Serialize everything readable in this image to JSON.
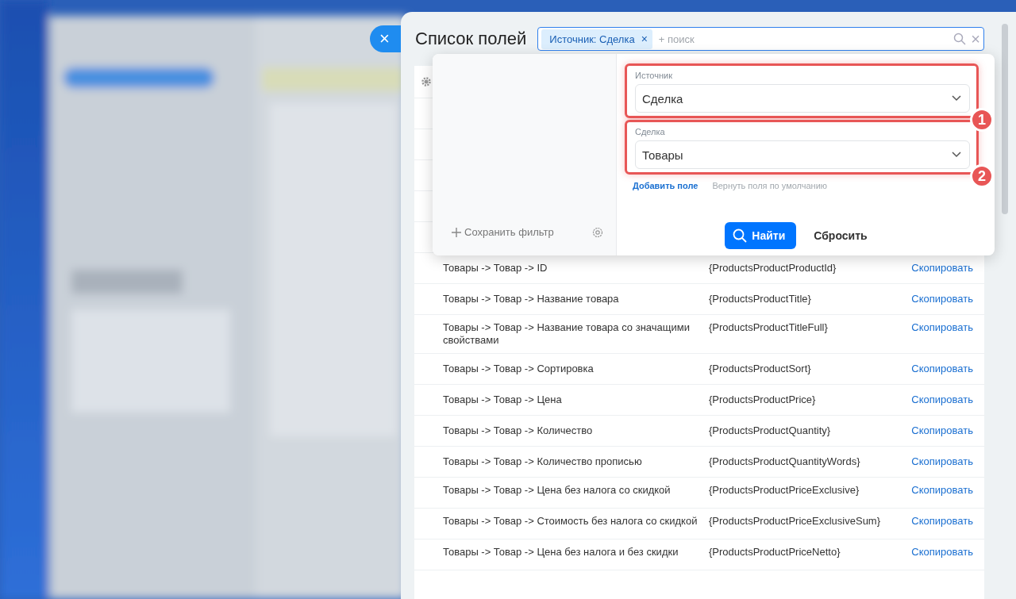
{
  "panel": {
    "title": "Список полей",
    "close_label": "×"
  },
  "search": {
    "tag": "Источник: Сделка",
    "tag_close": "×",
    "placeholder": "+ поиск",
    "clear_label": "×"
  },
  "filter_popup": {
    "save_filter": "Сохранить фильтр",
    "fields": [
      {
        "label": "Источник",
        "value": "Сделка",
        "callout": "1"
      },
      {
        "label": "Сделка",
        "value": "Товары",
        "callout": "2"
      }
    ],
    "add_field": "Добавить поле",
    "reset_fields": "Вернуть поля по умолчанию",
    "find_button": "Найти",
    "reset_button": "Сбросить"
  },
  "table": {
    "rows": [
      {
        "field": "Товары -> Товар -> ID",
        "code": "{ProductsProductProductId}",
        "action": "Скопировать"
      },
      {
        "field": "Товары -> Товар -> Название товара",
        "code": "{ProductsProductTitle}",
        "action": "Скопировать"
      },
      {
        "field": "Товары -> Товар -> Название товара со значащими свойствами",
        "code": "{ProductsProductTitleFull}",
        "action": "Скопировать"
      },
      {
        "field": "Товары -> Товар -> Сортировка",
        "code": "{ProductsProductSort}",
        "action": "Скопировать"
      },
      {
        "field": "Товары -> Товар -> Цена",
        "code": "{ProductsProductPrice}",
        "action": "Скопировать"
      },
      {
        "field": "Товары -> Товар -> Количество",
        "code": "{ProductsProductQuantity}",
        "action": "Скопировать"
      },
      {
        "field": "Товары -> Товар -> Количество прописью",
        "code": "{ProductsProductQuantityWords}",
        "action": "Скопировать"
      },
      {
        "field": "Товары -> Товар -> Цена без налога со скидкой",
        "code": "{ProductsProductPriceExclusive}",
        "action": "Скопировать"
      },
      {
        "field": "Товары -> Товар -> Стоимость без налога со скидкой",
        "code": "{ProductsProductPriceExclusiveSum}",
        "action": "Скопировать"
      },
      {
        "field": "Товары -> Товар -> Цена без налога и без скидки",
        "code": "{ProductsProductPriceNetto}",
        "action": "Скопировать"
      }
    ]
  }
}
